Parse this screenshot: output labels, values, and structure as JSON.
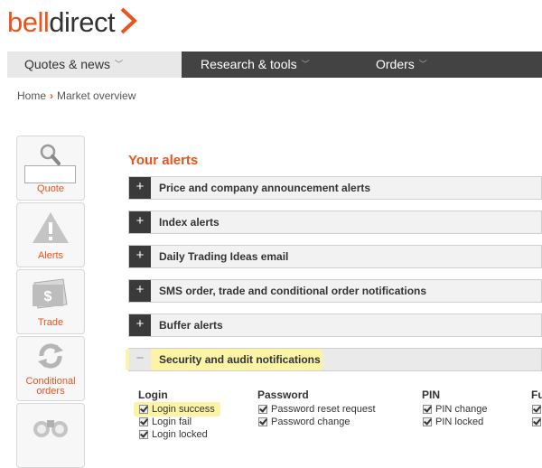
{
  "logo": {
    "part1": "bell",
    "part2": "direct"
  },
  "nav": {
    "quotes": "Quotes & news",
    "research": "Research & tools",
    "orders": "Orders",
    "chevron": "﹀"
  },
  "breadcrumb": {
    "home": "Home",
    "sep": "›",
    "current": "Market overview"
  },
  "sidebar": [
    {
      "label": "Quote",
      "icon": "magnifier-icon"
    },
    {
      "label": "Alerts",
      "icon": "warning-icon"
    },
    {
      "label": "Trade",
      "icon": "dollar-note-icon"
    },
    {
      "label": "Conditional orders",
      "line1": "Conditional",
      "line2": "orders",
      "icon": "refresh-icon"
    },
    {
      "label": "",
      "icon": "binoculars-icon"
    }
  ],
  "alerts": {
    "title": "Your alerts",
    "sections": [
      {
        "label": "Price and company announcement alerts",
        "toggle": "+"
      },
      {
        "label": "Index alerts",
        "toggle": "+"
      },
      {
        "label": "Daily Trading Ideas email",
        "toggle": "+"
      },
      {
        "label": "SMS order, trade and conditional order notifications",
        "toggle": "+"
      },
      {
        "label": "Buffer alerts",
        "toggle": "+"
      },
      {
        "label": "Security and audit notifications",
        "toggle": "−"
      }
    ]
  },
  "notifications": {
    "columns": [
      {
        "title": "Login",
        "items": [
          "Login success",
          "Login fail",
          "Login locked"
        ]
      },
      {
        "title": "Password",
        "items": [
          "Password reset request",
          "Password change"
        ]
      },
      {
        "title": "PIN",
        "items": [
          "PIN change",
          "PIN locked"
        ]
      },
      {
        "title": "Fu",
        "items": [
          "",
          ""
        ]
      }
    ]
  },
  "colors": {
    "accent": "#e8541e",
    "nav_dark": "#434343",
    "highlight": "#fbf4a7"
  }
}
